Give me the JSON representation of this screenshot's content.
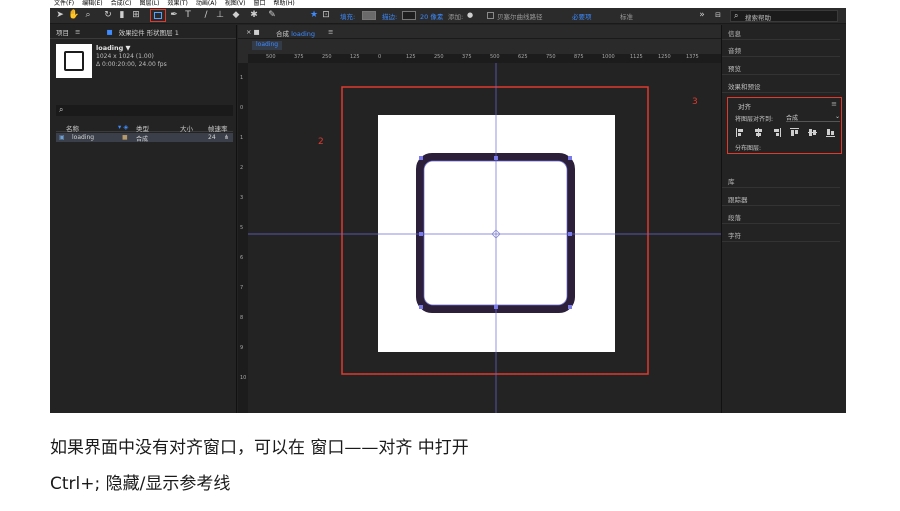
{
  "menubar": [
    "文件(F)",
    "编辑(E)",
    "合成(C)",
    "图层(L)",
    "效果(T)",
    "动画(A)",
    "视图(V)",
    "窗口",
    "帮助(H)"
  ],
  "toolbar": {
    "fill_label": "填充:",
    "stroke_label": "描边:",
    "stroke_width": "20 像素",
    "add_label": "添加:",
    "bezier_label": "贝塞尔曲线路径",
    "workspace_essentials": "必要项",
    "workspace_standard": "标准",
    "search_placeholder": "搜索帮助",
    "fill_color": "#6a6a6a"
  },
  "project": {
    "tab_project": "项目",
    "tab_effects": "效果控件 形状图层 1",
    "item_name": "loading ▼",
    "item_size": "1024 x 1024 (1.00)",
    "item_duration": "Δ 0:00:20:00, 24.00 fps",
    "search_icon": "⌕",
    "col_name": "名称",
    "col_type": "类型",
    "col_size": "大小",
    "col_fps": "帧速率",
    "row_name": "loading",
    "row_type": "合成",
    "row_fps": "24"
  },
  "comp": {
    "tab_prefix": "合成",
    "tab_name": "loading",
    "sub_tab": "loading",
    "ruler_h": [
      "500",
      "375",
      "250",
      "125",
      "0",
      "125",
      "250",
      "375",
      "500",
      "625",
      "750",
      "875",
      "1000",
      "1125",
      "1250",
      "1375"
    ],
    "ruler_v": [
      "1",
      "0",
      "1",
      "2",
      "3",
      "5",
      "6",
      "7",
      "8",
      "9",
      "10"
    ],
    "anno_2": "2",
    "anno_3": "3"
  },
  "right_panel": {
    "info": "信息",
    "audio": "音频",
    "preview": "预览",
    "effects_presets": "效果和预设",
    "align_title": "对齐",
    "align_to_label": "将图层对齐到:",
    "align_to_value": "合成",
    "distribute_label": "分布图层:",
    "library": "库",
    "tracker": "跟踪器",
    "paragraph": "段落",
    "character": "字符"
  },
  "captions": {
    "line1": "如果界面中没有对齐窗口，可以在 窗口——对齐  中打开",
    "line2": "Ctrl+;  隐藏/显示参考线"
  }
}
